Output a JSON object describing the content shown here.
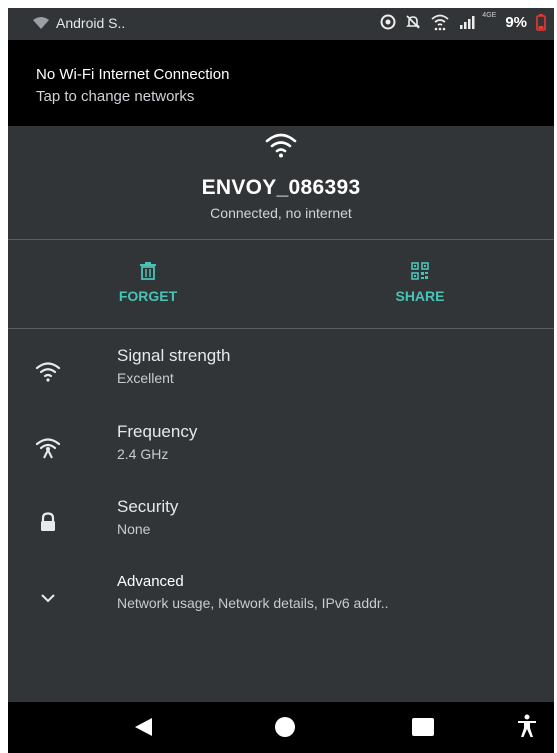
{
  "status_bar": {
    "notification_text": "Android S..",
    "battery_percent": "9%",
    "network_type": "4GE",
    "icons": [
      "wifi-assistant-icon",
      "cast-icon",
      "mute-icon",
      "wifi-icon",
      "cell-signal-icon",
      "battery-low-icon"
    ]
  },
  "banner": {
    "title": "No Wi-Fi Internet Connection",
    "subtitle": "Tap to change networks"
  },
  "network": {
    "ssid": "ENVOY_086393",
    "status": "Connected, no internet"
  },
  "actions": {
    "forget_label": "FORGET",
    "share_label": "SHARE"
  },
  "details": [
    {
      "icon": "wifi-signal-icon",
      "title": "Signal strength",
      "value": "Excellent"
    },
    {
      "icon": "frequency-icon",
      "title": "Frequency",
      "value": "2.4 GHz"
    },
    {
      "icon": "lock-icon",
      "title": "Security",
      "value": "None"
    },
    {
      "icon": "chevron-down-icon",
      "title": "Advanced",
      "value": "Network usage, Network details, IPv6 addr.."
    }
  ],
  "colors": {
    "background": "#323537",
    "accent": "#49c3b5",
    "banner": "#000000",
    "battery_low": "#e53935"
  }
}
